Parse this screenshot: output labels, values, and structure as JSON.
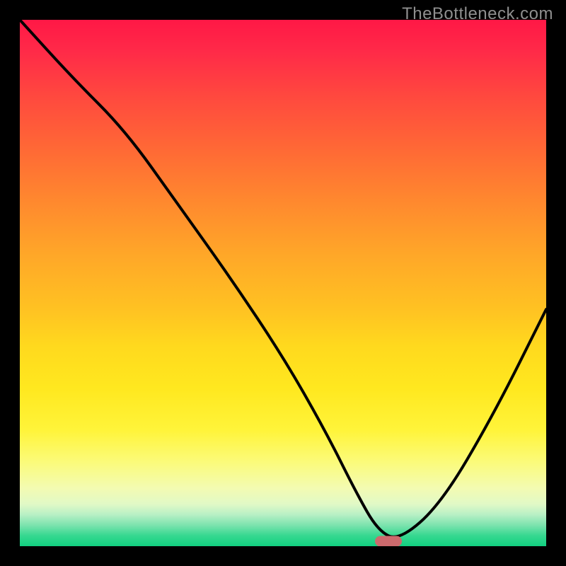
{
  "watermark": "TheBottleneck.com",
  "chart_data": {
    "type": "line",
    "title": "",
    "xlabel": "",
    "ylabel": "",
    "xlim": [
      0,
      100
    ],
    "ylim": [
      0,
      100
    ],
    "grid": false,
    "legend": false,
    "background": "rainbow-gradient",
    "series": [
      {
        "name": "bottleneck-curve",
        "color": "#000000",
        "x": [
          0,
          10,
          20,
          30,
          40,
          50,
          58,
          64,
          68,
          72,
          80,
          90,
          100
        ],
        "y": [
          100,
          89,
          79,
          65,
          51,
          36,
          22,
          10,
          3,
          1,
          8,
          25,
          45
        ]
      }
    ],
    "marker": {
      "name": "optimal-point",
      "x_percent": 70,
      "y_percent": 1,
      "color": "#cc6a6d",
      "shape": "pill"
    },
    "colors": {
      "gradient_top": "#ff1846",
      "gradient_mid": "#ffd91e",
      "gradient_bottom": "#11d081",
      "frame": "#000000"
    }
  }
}
